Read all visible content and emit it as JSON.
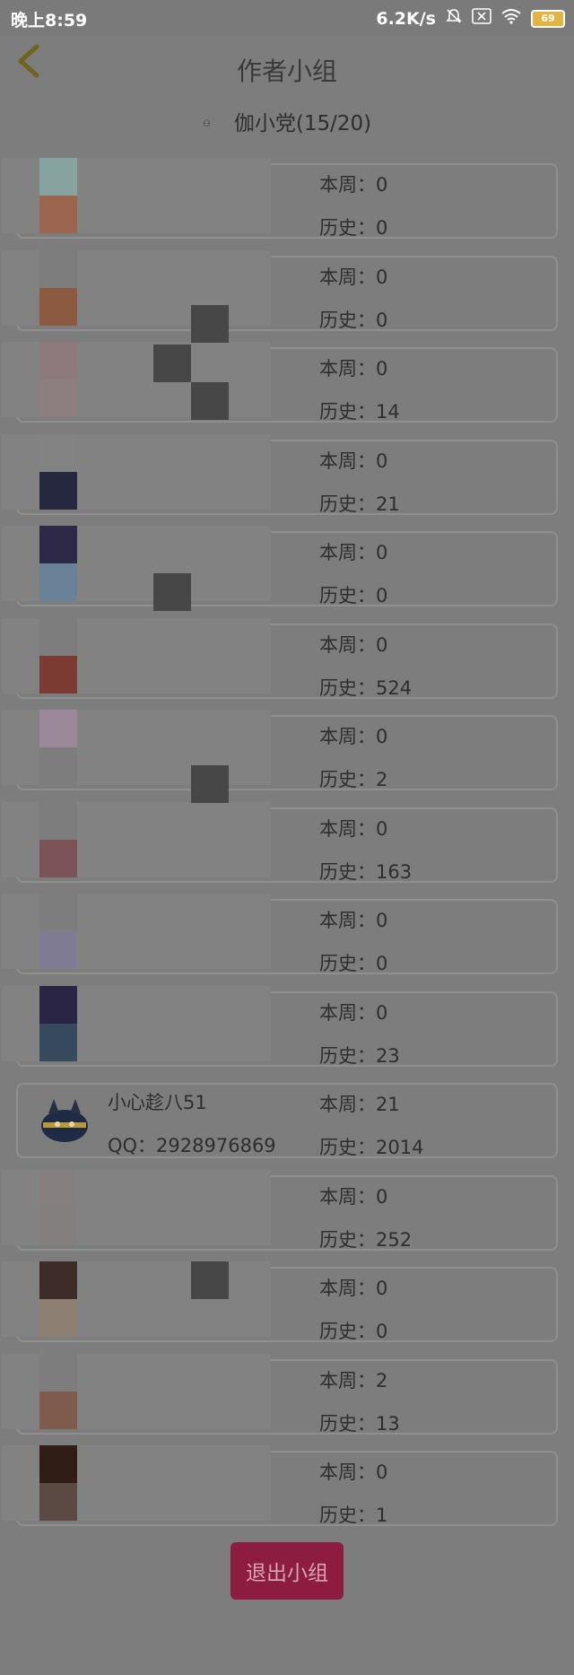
{
  "status_bar": {
    "time": "晚上8:59",
    "speed": "6.2K/s",
    "battery": "69"
  },
  "header": {
    "title": "作者小组"
  },
  "group": {
    "name": "伽小党(15/20)"
  },
  "members": [
    {
      "week": "本周：0",
      "total": "历史：0",
      "swatches": [
        "#86a3a0",
        "#9b6550"
      ]
    },
    {
      "week": "本周：0",
      "total": "历史：0",
      "swatches": [
        "#7d7d7d",
        "#8c5a40"
      ]
    },
    {
      "week": "本周：0",
      "total": "历史：14",
      "swatches": [
        "#8e7a7d",
        "#8d7f7f"
      ]
    },
    {
      "week": "本周：0",
      "total": "历史：21",
      "swatches": [
        "#838383",
        "#262840"
      ]
    },
    {
      "week": "本周：0",
      "total": "历史：0",
      "swatches": [
        "#2d2946",
        "#6a8298"
      ]
    },
    {
      "week": "本周：0",
      "total": "历史：524",
      "swatches": [
        "#7d7d7d",
        "#7b3b32"
      ]
    },
    {
      "week": "本周：0",
      "total": "历史：2",
      "swatches": [
        "#9b8999",
        "#7d7d7d"
      ]
    },
    {
      "week": "本周：0",
      "total": "历史：163",
      "swatches": [
        "#7d7d7d",
        "#7c5358"
      ]
    },
    {
      "week": "本周：0",
      "total": "历史：0",
      "swatches": [
        "#7d7d7d",
        "#7e7b92"
      ]
    },
    {
      "week": "本周：0",
      "total": "历史：23",
      "swatches": [
        "#2a2545",
        "#374a5d"
      ]
    },
    {
      "name": "小心趁八51",
      "qq": "QQ：2928976869",
      "week": "本周：21",
      "total": "历史：2014",
      "real_avatar": true
    },
    {
      "week": "本周：0",
      "total": "历史：252",
      "swatches": [
        "#857f80",
        "#837f7f"
      ]
    },
    {
      "week": "本周：0",
      "total": "历史：0",
      "swatches": [
        "#3e2c29",
        "#8e7f73"
      ]
    },
    {
      "week": "本周：2",
      "total": "历史：13",
      "swatches": [
        "#7d7d7d",
        "#7e5b4d"
      ]
    },
    {
      "week": "本周：0",
      "total": "历史：1",
      "swatches": [
        "#301d16",
        "#5b4a43"
      ]
    }
  ],
  "footer": {
    "exit_label": "退出小组"
  },
  "colors": {
    "accent": "#8c1d40",
    "back_arrow": "#8a7a2a"
  }
}
